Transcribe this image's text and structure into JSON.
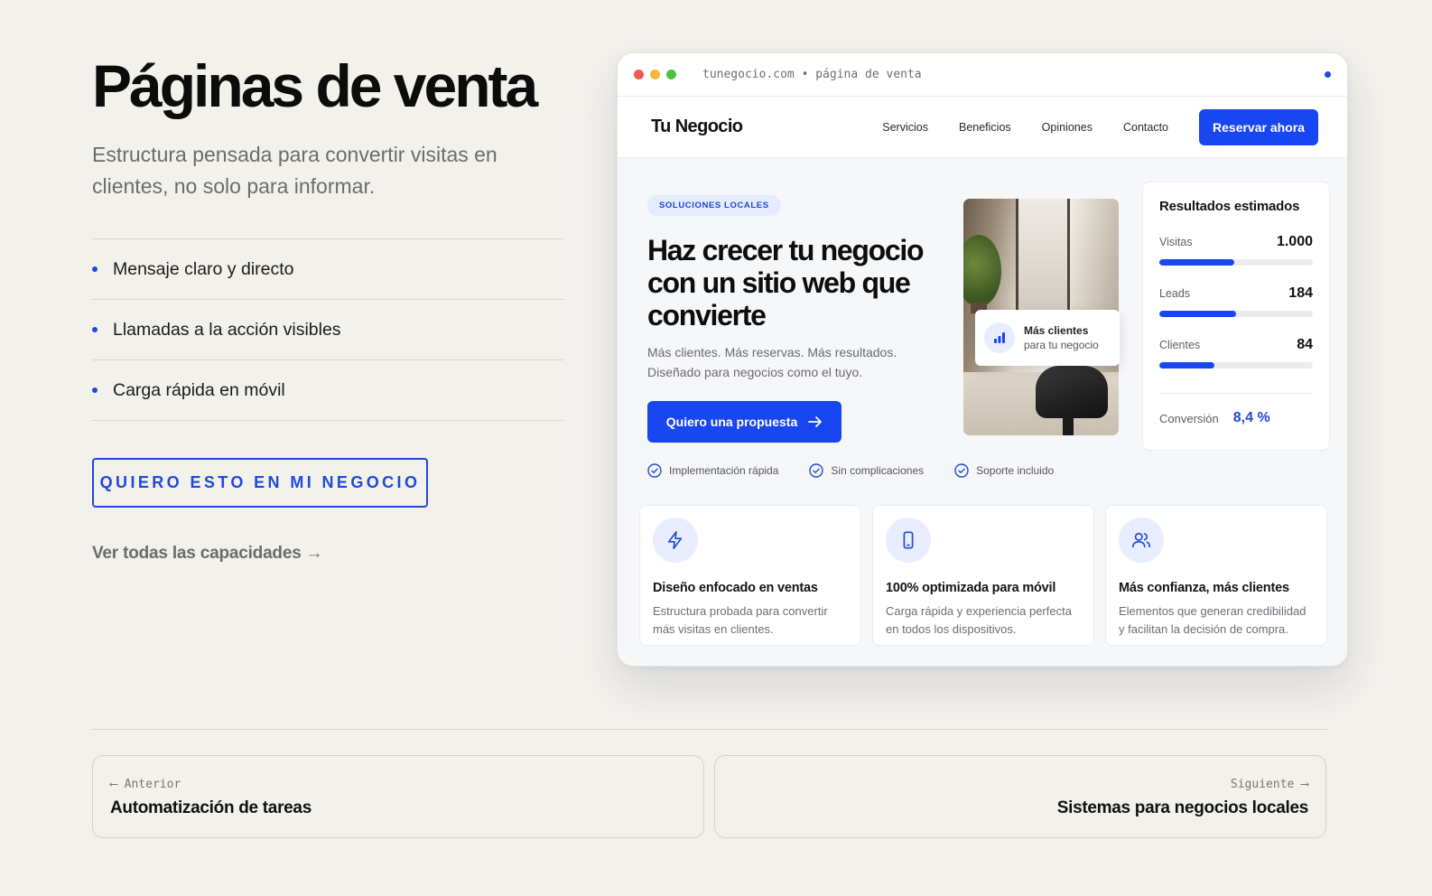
{
  "left": {
    "title": "Páginas de venta",
    "subtitle": "Estructura pensada para convertir visitas en clientes, no solo para informar.",
    "features": [
      "Mensaje claro y directo",
      "Llamadas a la acción visibles",
      "Carga rápida en móvil"
    ],
    "cta_label": "QUIERO ESTO EN MI NEGOCIO",
    "all_link": "Ver todas las capacidades →"
  },
  "mockup": {
    "url": "tunegocio.com • página de venta",
    "site": {
      "logo": "Tu Negocio",
      "nav": [
        "Servicios",
        "Beneficios",
        "Opiniones",
        "Contacto"
      ],
      "nav_cta": "Reservar ahora"
    },
    "hero": {
      "badge": "SOLUCIONES LOCALES",
      "title": "Haz crecer tu negocio con un sitio web que convierte",
      "text": "Más clientes. Más reservas. Más resultados. Diseñado para negocios como el tuyo.",
      "cta": "Quiero una propuesta"
    },
    "photo_card": {
      "title": "Más clientes",
      "subtitle": "para tu negocio"
    },
    "stats": {
      "title": "Resultados estimados",
      "items": [
        {
          "label": "Visitas",
          "value": "1.000",
          "fill": 0.49
        },
        {
          "label": "Leads",
          "value": "184",
          "fill": 0.5
        },
        {
          "label": "Clientes",
          "value": "84",
          "fill": 0.36
        }
      ],
      "conversion_label": "Conversión",
      "conversion_value": "8,4 %"
    },
    "checks": [
      "Implementación rápida",
      "Sin complicaciones",
      "Soporte incluido"
    ],
    "cards": [
      {
        "icon": "lightning-icon",
        "title": "Diseño enfocado en ventas",
        "text": "Estructura probada para convertir más visitas en clientes."
      },
      {
        "icon": "smartphone-icon",
        "title": "100% optimizada para móvil",
        "text": "Carga rápida y experiencia perfecta en todos los dispositivos."
      },
      {
        "icon": "users-icon",
        "title": "Más confianza, más clientes",
        "text": "Elementos que generan credibilidad y facilitan la decisión de compra."
      }
    ]
  },
  "pagination": {
    "prev_label": "⟵ Anterior",
    "prev_title": "Automatización de tareas",
    "next_label": "Siguiente ⟶",
    "next_title": "Sistemas para negocios locales"
  },
  "colors": {
    "accent": "#1846f0",
    "background": "#f3f1ec"
  }
}
